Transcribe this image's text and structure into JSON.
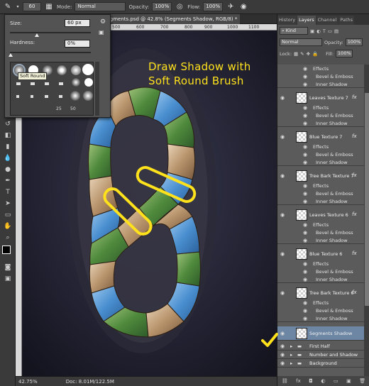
{
  "options_bar": {
    "brush_size": "60",
    "mode_label": "Mode:",
    "mode_value": "Normal",
    "opacity_label": "Opacity:",
    "opacity_value": "100%",
    "flow_label": "Flow:",
    "flow_value": "100%"
  },
  "document": {
    "tab_title": "Segments.psd @ 42.8% (Segments Shadow, RGB/8) *",
    "ruler_ticks": [
      "500",
      "600",
      "700",
      "800",
      "900",
      "1000",
      "1100",
      "1200",
      "1300",
      "1400"
    ],
    "zoom": "42.75%",
    "doc_info": "Doc: 8.01M/122.5M"
  },
  "brush_popup": {
    "size_label": "Size:",
    "size_value": "60 px",
    "hardness_label": "Hardness:",
    "hardness_value": "0%",
    "preset_numbers": [
      "25",
      "50"
    ],
    "tooltip": "Soft Round"
  },
  "annotation": {
    "line1": "Draw Shadow with",
    "line2": "Soft Round Brush",
    "color": "#ffe11c"
  },
  "panel": {
    "tabs": [
      "History",
      "Layers",
      "Channel",
      "Paths"
    ],
    "active_tab": "Layers",
    "kind_label": "Kind",
    "blend_mode": "Normal",
    "opacity_label": "Opacity:",
    "opacity_value": "100%",
    "lock_label": "Lock:",
    "fill_label": "Fill:",
    "fill_value": "100%",
    "layers": [
      {
        "name": "Tree Bark Texture 8",
        "effects": [
          "Effects",
          "Bevel & Emboss",
          "Inner Shadow"
        ]
      },
      {
        "name": "Leaves Texture 7",
        "effects": [
          "Effects",
          "Bevel & Emboss",
          "Inner Shadow"
        ]
      },
      {
        "name": "Blue Texture 7",
        "effects": [
          "Effects",
          "Bevel & Emboss",
          "Inner Shadow"
        ]
      },
      {
        "name": "Tree Bark Texture 7",
        "effects": [
          "Effects",
          "Bevel & Emboss",
          "Inner Shadow"
        ]
      },
      {
        "name": "Leaves Texture 6",
        "effects": [
          "Effects",
          "Bevel & Emboss",
          "Inner Shadow"
        ]
      },
      {
        "name": "Blue Texture 6",
        "effects": [
          "Effects",
          "Bevel & Emboss",
          "Inner Shadow"
        ]
      },
      {
        "name": "Tree Bark Texture 6",
        "effects": [
          "Effects",
          "Bevel & Emboss",
          "Inner Shadow"
        ]
      }
    ],
    "selected_layer": "Segments Shadow",
    "groups": [
      "First Half",
      "Number and Shadow",
      "Background"
    ],
    "fx_label": "fx"
  },
  "colors": {
    "selection": "#6c86a4",
    "checkmark": "#ffe11c"
  }
}
